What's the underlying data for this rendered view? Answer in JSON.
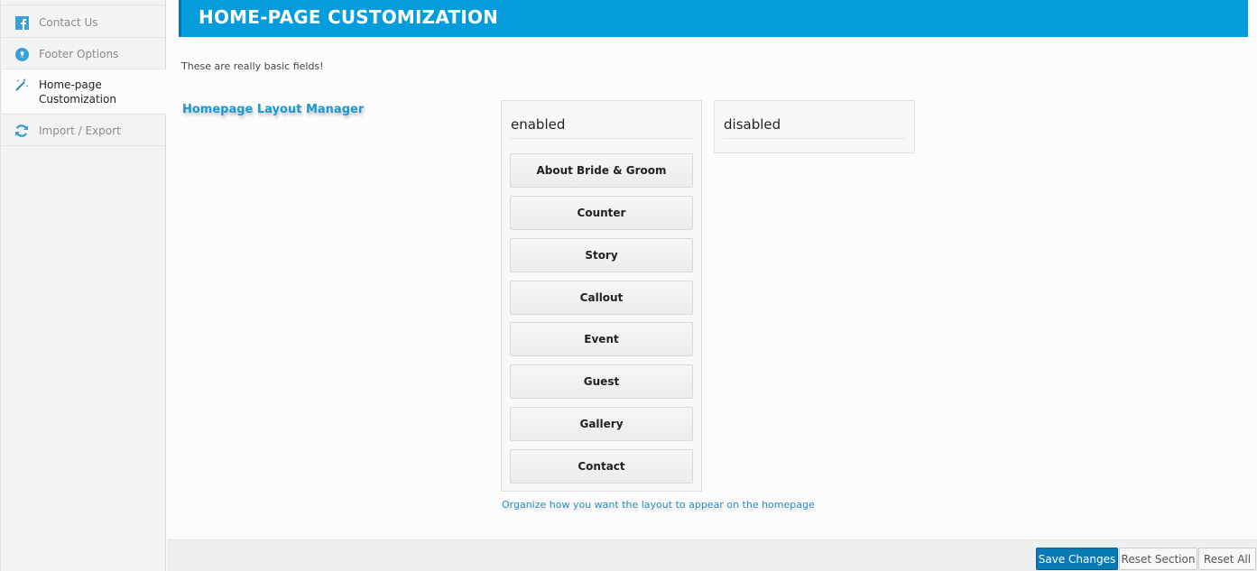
{
  "sidebar": {
    "items": [
      {
        "label": "Contact Us",
        "icon": "facebook-icon"
      },
      {
        "label": "Footer Options",
        "icon": "lightbulb-icon"
      },
      {
        "label": "Home-page Customization",
        "icon": "magic-wand-icon",
        "active": true
      },
      {
        "label": "Import / Export",
        "icon": "refresh-icon"
      }
    ]
  },
  "header": {
    "title": "HOME-PAGE CUSTOMIZATION"
  },
  "section": {
    "description": "These are really basic fields!",
    "field_title": "Homepage Layout Manager",
    "hint": "Organize how you want the layout to appear on the homepage"
  },
  "sorter": {
    "enabled_title": "enabled",
    "disabled_title": "disabled",
    "enabled_items": [
      "About Bride & Groom",
      "Counter",
      "Story",
      "Callout",
      "Event",
      "Guest",
      "Gallery",
      "Contact"
    ],
    "disabled_items": []
  },
  "footer": {
    "save_label": "Save Changes",
    "reset_section_label": "Reset Section",
    "reset_all_label": "Reset All"
  },
  "colors": {
    "accent": "#049cdb",
    "save_button": "#0a7ab5",
    "link": "#1a9ad1"
  }
}
